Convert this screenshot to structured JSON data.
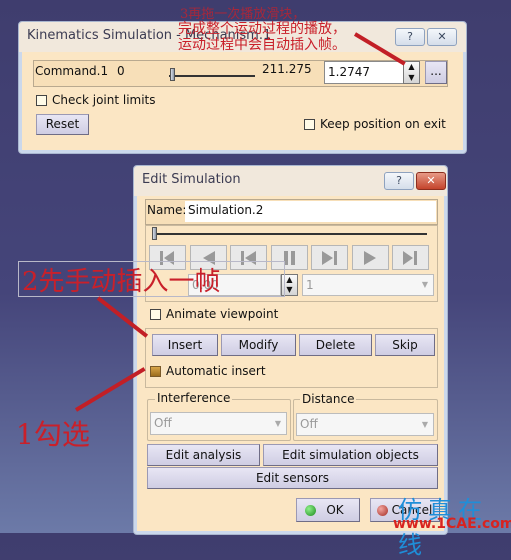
{
  "kinematics_dialog": {
    "title": "Kinematics Simulation - Mechanism.1",
    "help_label": "?",
    "close_label": "✕",
    "command_label": "Command.1",
    "range_min": "0",
    "range_max": "211.275",
    "slider_fraction": 0.006,
    "value": "1.2747",
    "more_label": "...",
    "check_joint_limits": {
      "label": "Check joint limits",
      "checked": false
    },
    "reset_label": "Reset",
    "keep_position": {
      "label": "Keep position on exit",
      "checked": false
    }
  },
  "edit_dialog": {
    "title": "Edit Simulation",
    "help_label": "?",
    "close_label": "✕",
    "name_label": "Name:",
    "name_value": "Simulation.2",
    "timeline_fraction": 0.0,
    "player_buttons": [
      "skip-to-start",
      "step-back",
      "play-backward",
      "pause",
      "play-forward",
      "step-forward",
      "skip-to-end"
    ],
    "step_value": "0.00",
    "step_select": "1",
    "animate_viewpoint": {
      "label": "Animate viewpoint",
      "checked": false
    },
    "buttons": {
      "insert": "Insert",
      "modify": "Modify",
      "delete": "Delete",
      "skip": "Skip"
    },
    "automatic_insert": {
      "label": "Automatic insert",
      "checked": true
    },
    "interference": {
      "title": "Interference",
      "value": "Off"
    },
    "distance": {
      "title": "Distance",
      "value": "Off"
    },
    "edit_analysis_label": "Edit analysis",
    "edit_simulation_objects_label": "Edit simulation objects",
    "edit_sensors_label": "Edit sensors",
    "ok_label": "OK",
    "cancel_label": "Cancel"
  },
  "annotations": {
    "note_top_line1": "3再拖一次播放滑块，",
    "note_top_line2": "完成整个运动过程的播放，",
    "note_top_line3": "运动过程中会自动插入帧。",
    "note_insert": "2先手动插入一帧",
    "note_check": "1勾选",
    "accent_red": "#c9202a"
  },
  "watermark": {
    "text_cn": "仿真在线",
    "url": "www.1CAE.com",
    "color_cn": "#1f8ed8",
    "color_url": "#d8231f"
  }
}
